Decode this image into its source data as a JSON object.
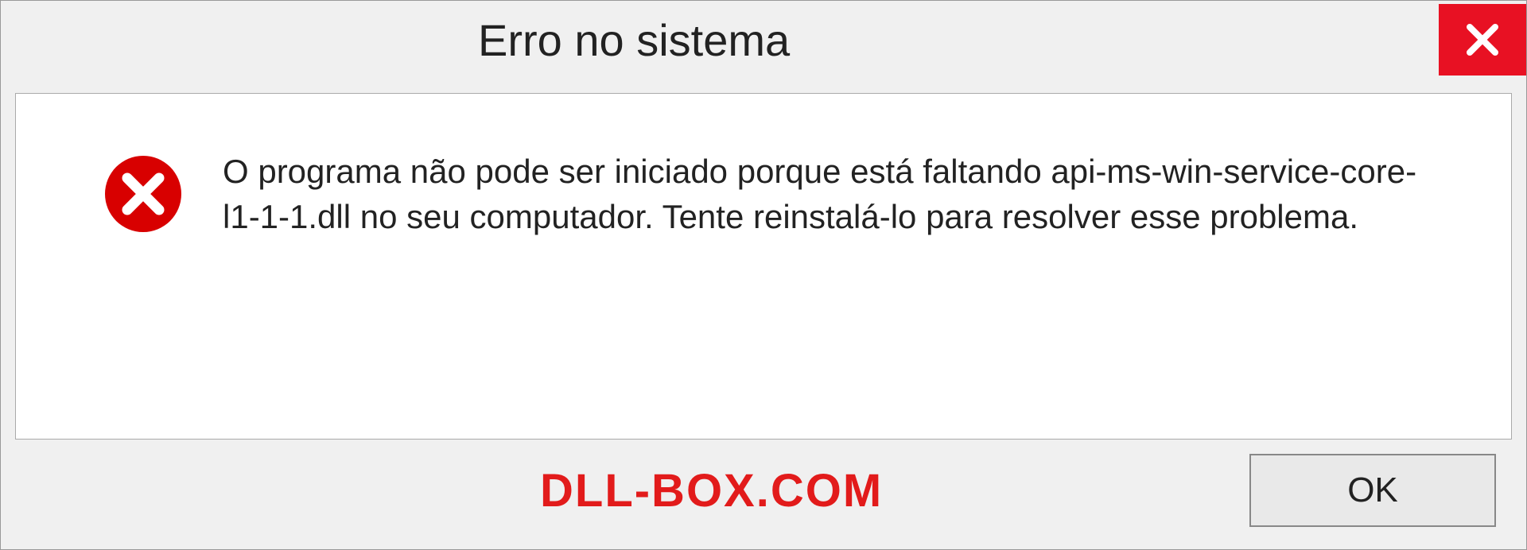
{
  "titlebar": {
    "title": "Erro no sistema"
  },
  "message": {
    "text": "O programa não pode ser iniciado porque está faltando api-ms-win-service-core-l1-1-1.dll no seu computador. Tente reinstalá-lo para resolver esse problema."
  },
  "footer": {
    "watermark": "DLL-BOX.COM",
    "ok_label": "OK"
  },
  "colors": {
    "close_button_bg": "#e81123",
    "error_icon": "#d80000",
    "watermark": "#e21b1b"
  }
}
